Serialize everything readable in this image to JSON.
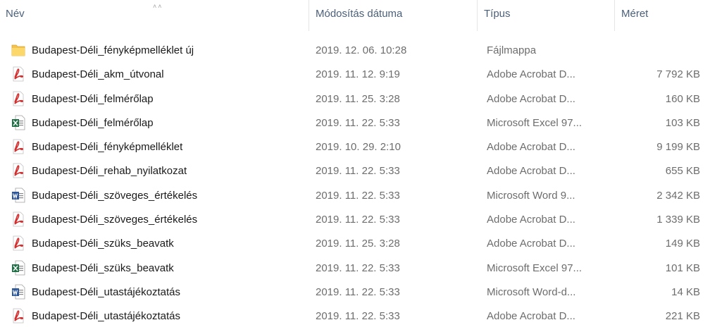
{
  "header": {
    "name": "Név",
    "date": "Módosítás dátuma",
    "type": "Típus",
    "size": "Méret"
  },
  "colors": {
    "header_text": "#4c607a",
    "folder": "#f3c24f",
    "pdf": "#d42e2e",
    "excel": "#1e7145",
    "word": "#2b579a"
  },
  "files": [
    {
      "icon": "folder",
      "name": "Budapest-Déli_fényképmelléklet új",
      "date": "2019. 12. 06. 10:28",
      "type": "Fájlmappa",
      "size": ""
    },
    {
      "icon": "pdf",
      "name": "Budapest-Déli_akm_útvonal",
      "date": "2019. 11. 12. 9:19",
      "type": "Adobe Acrobat D...",
      "size": "7 792 KB"
    },
    {
      "icon": "pdf",
      "name": "Budapest-Déli_felmérőlap",
      "date": "2019. 11. 25. 3:28",
      "type": "Adobe Acrobat D...",
      "size": "160 KB"
    },
    {
      "icon": "excel",
      "name": "Budapest-Déli_felmérőlap",
      "date": "2019. 11. 22. 5:33",
      "type": "Microsoft Excel 97...",
      "size": "103 KB"
    },
    {
      "icon": "pdf",
      "name": "Budapest-Déli_fényképmelléklet",
      "date": "2019. 10. 29. 2:10",
      "type": "Adobe Acrobat D...",
      "size": "9 199 KB"
    },
    {
      "icon": "pdf",
      "name": "Budapest-Déli_rehab_nyilatkozat",
      "date": "2019. 11. 22. 5:33",
      "type": "Adobe Acrobat D...",
      "size": "655 KB"
    },
    {
      "icon": "word",
      "name": "Budapest-Déli_szöveges_értékelés",
      "date": "2019. 11. 22. 5:33",
      "type": "Microsoft Word 9...",
      "size": "2 342 KB"
    },
    {
      "icon": "pdf",
      "name": "Budapest-Déli_szöveges_értékelés",
      "date": "2019. 11. 22. 5:33",
      "type": "Adobe Acrobat D...",
      "size": "1 339 KB"
    },
    {
      "icon": "pdf",
      "name": "Budapest-Déli_szüks_beavatk",
      "date": "2019. 11. 25. 3:28",
      "type": "Adobe Acrobat D...",
      "size": "149 KB"
    },
    {
      "icon": "excel",
      "name": "Budapest-Déli_szüks_beavatk",
      "date": "2019. 11. 22. 5:33",
      "type": "Microsoft Excel 97...",
      "size": "101 KB"
    },
    {
      "icon": "word",
      "name": "Budapest-Déli_utastájékoztatás",
      "date": "2019. 11. 22. 5:33",
      "type": "Microsoft Word-d...",
      "size": "14 KB"
    },
    {
      "icon": "pdf",
      "name": "Budapest-Déli_utastájékoztatás",
      "date": "2019. 11. 22. 5:33",
      "type": "Adobe Acrobat D...",
      "size": "221 KB"
    }
  ]
}
